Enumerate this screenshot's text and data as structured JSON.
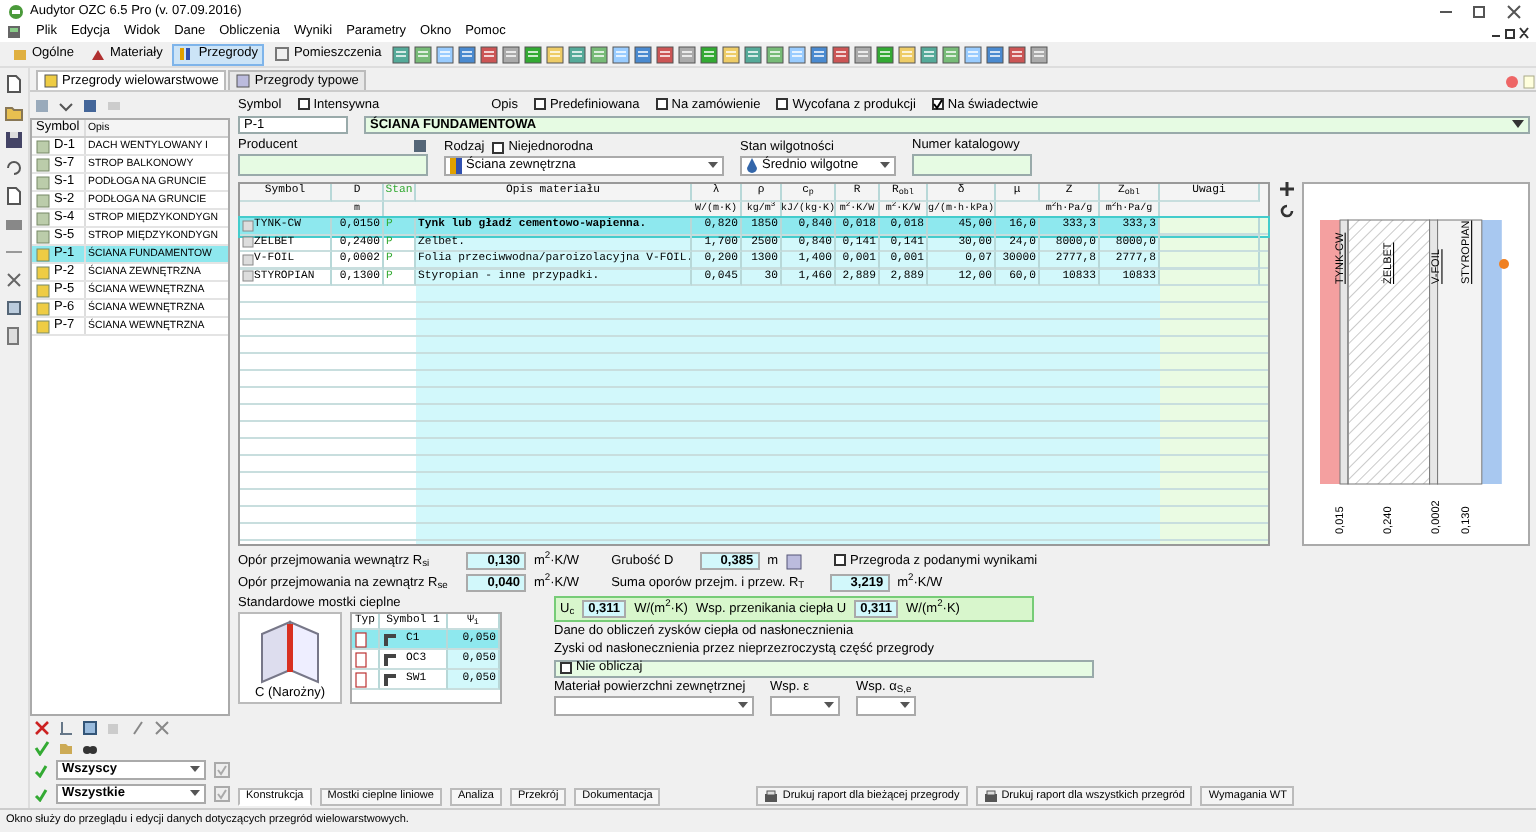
{
  "window": {
    "title": "Audytor OZC 6.5 Pro (v. 07.09.2016)"
  },
  "menu": [
    "Plik",
    "Edycja",
    "Widok",
    "Dane",
    "Obliczenia",
    "Wyniki",
    "Parametry",
    "Okno",
    "Pomoc"
  ],
  "toolbar": [
    {
      "label": "Ogólne",
      "selected": false
    },
    {
      "label": "Materiały",
      "selected": false
    },
    {
      "label": "Przegrody",
      "selected": true
    },
    {
      "label": "Pomieszczenia",
      "selected": false
    }
  ],
  "tabs": [
    {
      "label": "Przegrody wielowarstwowe",
      "selected": true
    },
    {
      "label": "Przegrody typowe",
      "selected": false
    }
  ],
  "list": {
    "columns": [
      "Symbol",
      "Opis"
    ],
    "rows": [
      {
        "symbol": "D-1",
        "description": "DACH WENTYLOWANY I",
        "selected": false
      },
      {
        "symbol": "S-7",
        "description": "STROP BALKONOWY",
        "selected": false
      },
      {
        "symbol": "S-1",
        "description": "PODŁOGA NA GRUNCIE",
        "selected": false
      },
      {
        "symbol": "S-2",
        "description": "PODŁOGA NA GRUNCIE",
        "selected": false
      },
      {
        "symbol": "S-4",
        "description": "STROP MIĘDZYKONDYGN",
        "selected": false
      },
      {
        "symbol": "S-5",
        "description": "STROP MIĘDZYKONDYGN",
        "selected": false
      },
      {
        "symbol": "P-1",
        "description": "ŚCIANA FUNDAMENTOW",
        "selected": true
      },
      {
        "symbol": "P-2",
        "description": "ŚCIANA ZEWNĘTRZNA",
        "selected": false
      },
      {
        "symbol": "P-5",
        "description": "ŚCIANA WEWNĘTRZNA",
        "selected": false
      },
      {
        "symbol": "P-6",
        "description": "ŚCIANA WEWNĘTRZNA",
        "selected": false
      },
      {
        "symbol": "P-7",
        "description": "ŚCIANA WEWNĘTRZNA",
        "selected": false
      }
    ]
  },
  "filters": [
    "Wszyscy",
    "Wszystkie"
  ],
  "form": {
    "symbol_label": "Symbol",
    "intensive": {
      "label": "Intensywna",
      "checked": false
    },
    "description_label": "Opis",
    "flags": [
      {
        "label": "Predefiniowana",
        "checked": false
      },
      {
        "label": "Na zamówienie",
        "checked": false
      },
      {
        "label": "Wycofana z produkcji",
        "checked": false
      },
      {
        "label": "Na świadectwie",
        "checked": true
      }
    ],
    "symbol": "P-1",
    "description": "ŚCIANA FUNDAMENTOWA",
    "producer_label": "Producent",
    "type_label": "Rodzaj",
    "inhomogeneous": {
      "label": "Niejednorodna",
      "checked": false
    },
    "type": "Ściana zewnętrzna",
    "moisture_label": "Stan wilgotności",
    "moisture": "Średnio wilgotne",
    "catalog_label": "Numer katalogowy"
  },
  "layers": {
    "columns": [
      {
        "name": "Symbol",
        "kind": "id"
      },
      {
        "name": "D",
        "unit": "m",
        "kind": "input"
      },
      {
        "name": "Stan",
        "kind": "state"
      },
      {
        "name": "Opis materiału",
        "kind": "text"
      },
      {
        "name": "λ",
        "unit": "W/(m·K)",
        "kind": "number"
      },
      {
        "name": "ρ",
        "unit": "kg/m$^{3}$",
        "kind": "number"
      },
      {
        "name": "c$_{p}$",
        "unit": "kJ/(kg·K)",
        "kind": "number"
      },
      {
        "name": "R",
        "unit": "m$^{2}$·K/W",
        "kind": "number"
      },
      {
        "name": "R$_{obl}$",
        "unit": "m$^{2}$·K/W",
        "kind": "number"
      },
      {
        "name": "δ",
        "unit": "g/(m·h·kPa)",
        "kind": "number"
      },
      {
        "name": "μ",
        "kind": "number"
      },
      {
        "name": "Z",
        "unit": "m$^{2}$h·Pa/g",
        "kind": "number"
      },
      {
        "name": "Z$_{obl}$",
        "unit": "m$^{2}$h·Pa/g",
        "kind": "number"
      },
      {
        "name": "Uwagi",
        "kind": "note"
      }
    ],
    "rows": [
      {
        "selected": true,
        "values": [
          "TYNK-CW",
          "0,0150",
          "P",
          "Tynk lub gładź cementowo-wapienna.",
          "0,820",
          "1850",
          "0,840",
          "0,018",
          "0,018",
          "45,00",
          "16,0",
          "333,3",
          "333,3"
        ]
      },
      {
        "selected": false,
        "values": [
          "ŻELBET",
          "0,2400",
          "P",
          "Żelbet.",
          "1,700",
          "2500",
          "0,840",
          "0,141",
          "0,141",
          "30,00",
          "24,0",
          "8000,0",
          "8000,0"
        ]
      },
      {
        "selected": false,
        "values": [
          "V-FOIL",
          "0,0002",
          "P",
          "Folia przeciwwodna/paroizolacyjna V-FOIL.",
          "0,200",
          "1300",
          "1,400",
          "0,001",
          "0,001",
          "0,07",
          "30000",
          "2777,8",
          "2777,8"
        ]
      },
      {
        "selected": false,
        "values": [
          "STYROPIAN",
          "0,1300",
          "P",
          "Styropian - inne przypadki.",
          "0,045",
          "30",
          "1,460",
          "2,889",
          "2,889",
          "12,00",
          "60,0",
          "10833",
          "10833"
        ]
      }
    ]
  },
  "section_drawing": {
    "layers": [
      {
        "label": "TYNK-CW",
        "thickness": "0,015"
      },
      {
        "label": "ŻELBET",
        "thickness": "0,240"
      },
      {
        "label": "V-FOIL",
        "thickness": "0,0002"
      },
      {
        "label": "STYROPIAN",
        "thickness": "0,130"
      }
    ]
  },
  "resistances": {
    "rsi_label": "Opór przejmowania wewnątrz R$_{si}$",
    "rsi": "0,130",
    "rsi_unit": "m$^{2}$·K/W",
    "thickness_label": "Grubość D",
    "thickness": "0,385",
    "thickness_unit": "m",
    "given_results": {
      "label": "Przegroda z podanymi wynikami",
      "checked": false
    },
    "rse_label": "Opór przejmowania na zewnątrz R$_{se}$",
    "rse": "0,040",
    "rse_unit": "m$^{2}$·K/W",
    "rt_label": "Suma oporów przejm. i przew. R$_{T}$",
    "rt": "3,219",
    "rt_unit": "m$^{2}$·K/W"
  },
  "bridges": {
    "title": "Standardowe mostki cieplne",
    "picture_label": "C (Narożny)",
    "columns": [
      "Typ",
      "Symbol 1",
      "Ψ$_{i}$"
    ],
    "rows": [
      {
        "symbol": "C1",
        "value": "0,050",
        "selected": true
      },
      {
        "symbol": "OC3",
        "value": "0,050",
        "selected": false
      },
      {
        "symbol": "SW1",
        "value": "0,050",
        "selected": false
      }
    ]
  },
  "u_value": {
    "uc_label": "U$_{c}$",
    "uc": "0,311",
    "uc_unit": "W/(m$^{2}$·K)",
    "u_label": "Wsp. przenikania ciepła U",
    "u": "0,311",
    "u_unit": "W/(m$^{2}$·K)"
  },
  "solar": {
    "title": "Dane do obliczeń zysków ciepła od nasłonecznienia",
    "subtitle": "Zyski od nasłonecznienia przez nieprzezroczystą część przegrody",
    "skip": {
      "label": "Nie obliczaj",
      "checked": false
    },
    "material_label": "Materiał powierzchni zewnętrznej",
    "epsilon_label": "Wsp. ε",
    "alpha_label": "Wsp. α$_{S,e}$"
  },
  "bottom_tabs": [
    {
      "label": "Konstrukcja",
      "selected": true
    },
    {
      "label": "Mostki cieplne liniowe",
      "selected": false
    },
    {
      "label": "Analiza",
      "selected": false
    },
    {
      "label": "Przekrój",
      "selected": false
    },
    {
      "label": "Dokumentacja",
      "selected": false
    }
  ],
  "report_buttons": [
    "Drukuj raport dla bieżącej przegrody",
    "Drukuj raport dla wszystkich przegród",
    "Wymagania WT"
  ],
  "status_bar": "Okno służy do przeglądu i edycji danych dotyczących przegród wielowarstwowych."
}
